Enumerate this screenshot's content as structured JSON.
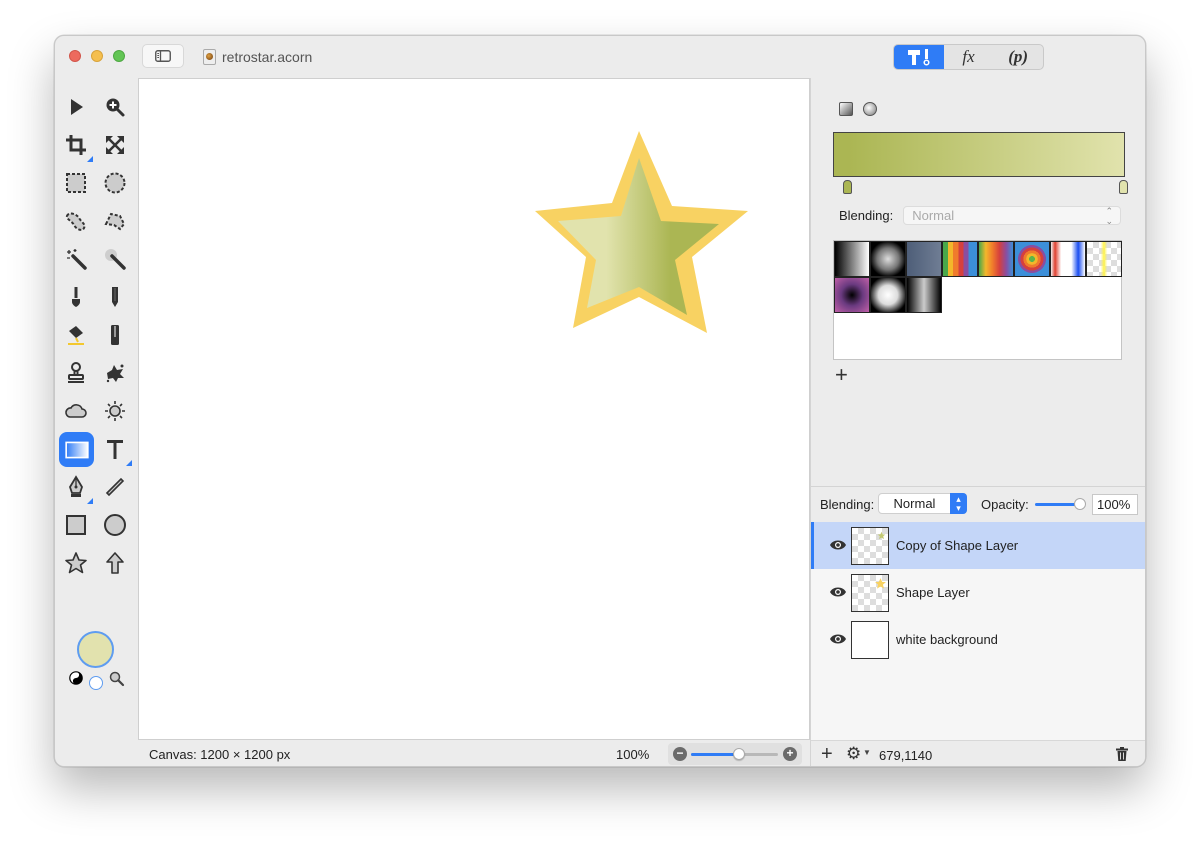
{
  "window": {
    "document_title": "retrostar.acorn",
    "traffic_lights": [
      "close",
      "minimize",
      "zoom"
    ],
    "sidebar_toggle_icon": "sidebar-icon"
  },
  "inspector_tabs": [
    {
      "name": "tools",
      "icon": "hammer-tools-icon",
      "label": "",
      "active": true
    },
    {
      "name": "filters",
      "icon": "fx-icon",
      "label": "fx",
      "active": false
    },
    {
      "name": "properties",
      "icon": "p-icon",
      "label": "(p)",
      "active": false
    }
  ],
  "toolbox": {
    "tools": [
      {
        "name": "select",
        "icon": "arrow-pointer-icon"
      },
      {
        "name": "zoom",
        "icon": "zoom-in-icon"
      },
      {
        "name": "crop",
        "icon": "crop-icon",
        "has_submenu": true
      },
      {
        "name": "transform",
        "icon": "expand-arrows-icon"
      },
      {
        "name": "rect-select",
        "icon": "rect-marquee-icon"
      },
      {
        "name": "oval-select",
        "icon": "oval-marquee-icon"
      },
      {
        "name": "lasso",
        "icon": "lasso-icon"
      },
      {
        "name": "polygon-lasso",
        "icon": "polygon-lasso-icon"
      },
      {
        "name": "magic-wand",
        "icon": "magic-wand-icon"
      },
      {
        "name": "instant-alpha",
        "icon": "instant-alpha-icon"
      },
      {
        "name": "brush",
        "icon": "brush-icon"
      },
      {
        "name": "pencil",
        "icon": "pencil-icon"
      },
      {
        "name": "paint-bucket",
        "icon": "paint-bucket-icon"
      },
      {
        "name": "eraser",
        "icon": "eraser-icon"
      },
      {
        "name": "clone",
        "icon": "stamp-icon"
      },
      {
        "name": "smudge",
        "icon": "splatter-icon"
      },
      {
        "name": "burn",
        "icon": "cloud-icon"
      },
      {
        "name": "dodge",
        "icon": "sun-icon"
      },
      {
        "name": "gradient",
        "icon": "gradient-icon",
        "selected": true
      },
      {
        "name": "text",
        "icon": "text-icon",
        "has_submenu": true
      },
      {
        "name": "bezier",
        "icon": "pen-nib-icon",
        "has_submenu": true
      },
      {
        "name": "line",
        "icon": "line-icon"
      },
      {
        "name": "rectangle",
        "icon": "rectangle-icon"
      },
      {
        "name": "oval",
        "icon": "oval-icon"
      },
      {
        "name": "star",
        "icon": "star-icon"
      },
      {
        "name": "arrow",
        "icon": "arrow-up-icon"
      }
    ],
    "fill_color": "#e2e2ae",
    "small_tools": [
      "swap-colors-icon",
      "stroke-color-icon",
      "loupe-icon"
    ]
  },
  "canvas": {
    "star": {
      "stroke_color": "#f8d262",
      "fill_start": "#e1e3ad",
      "fill_end": "#abb653"
    }
  },
  "status": {
    "canvas_size": "Canvas: 1200 × 1200 px",
    "zoom_percent": "100%",
    "zoom_slider_value": 0.55,
    "zoom_minus": "−",
    "zoom_plus": "+"
  },
  "gradient_panel": {
    "type_icons": [
      "linear-gradient-icon",
      "radial-gradient-icon"
    ],
    "start_color": "#abb653",
    "end_color": "#e1e3ad",
    "blending_label": "Blending:",
    "blending_value": "Normal",
    "presets": [
      {
        "name": "black-white"
      },
      {
        "name": "radial-gray"
      },
      {
        "name": "slate-blue"
      },
      {
        "name": "rainbow-stripes"
      },
      {
        "name": "rainbow-smooth"
      },
      {
        "name": "radial-rainbow"
      },
      {
        "name": "red-white-blue"
      },
      {
        "name": "yellow-transparent"
      },
      {
        "name": "purple-radial"
      },
      {
        "name": "white-radial"
      },
      {
        "name": "silver-bars"
      }
    ],
    "add_label": "+"
  },
  "layers_panel": {
    "blending_label": "Blending:",
    "blending_value": "Normal",
    "opacity_label": "Opacity:",
    "opacity_value": "100%",
    "opacity_fraction": 1.0,
    "layers": [
      {
        "name": "Copy of Shape Layer",
        "visible": true,
        "selected": true,
        "thumb": "transparent-star-green"
      },
      {
        "name": "Shape Layer",
        "visible": true,
        "selected": false,
        "thumb": "transparent-star-yellow"
      },
      {
        "name": "white background",
        "visible": true,
        "selected": false,
        "thumb": "white"
      }
    ],
    "footer": {
      "add_label": "+",
      "gear_label": "⚙",
      "coords": "679,1140"
    }
  }
}
